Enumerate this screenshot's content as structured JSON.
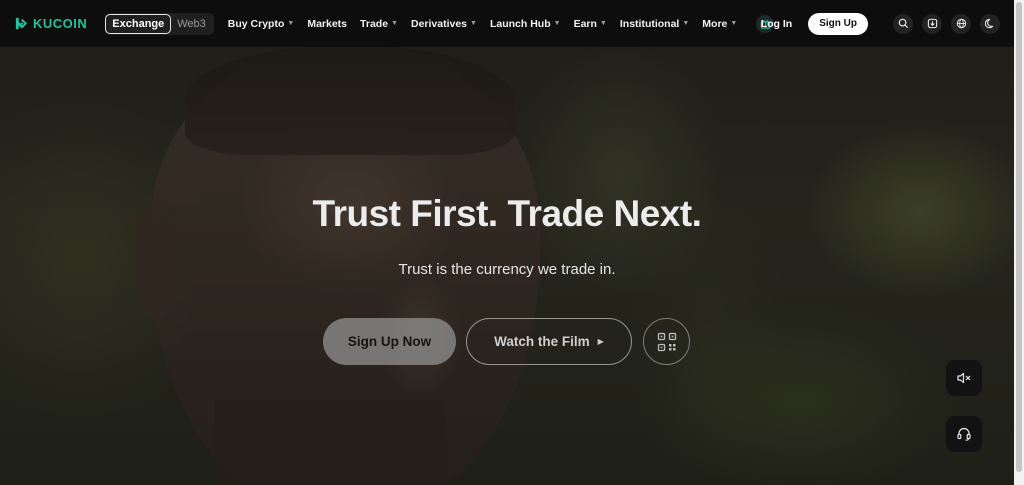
{
  "header": {
    "brand": "KUCOIN",
    "mode_switch": {
      "active": "Exchange",
      "inactive": "Web3"
    },
    "nav": [
      {
        "label": "Buy Crypto",
        "has_dropdown": true
      },
      {
        "label": "Markets",
        "has_dropdown": false
      },
      {
        "label": "Trade",
        "has_dropdown": true
      },
      {
        "label": "Derivatives",
        "has_dropdown": true
      },
      {
        "label": "Launch Hub",
        "has_dropdown": true
      },
      {
        "label": "Earn",
        "has_dropdown": true
      },
      {
        "label": "Institutional",
        "has_dropdown": true
      },
      {
        "label": "More",
        "has_dropdown": true
      }
    ],
    "login_label": "Log In",
    "signup_label": "Sign Up",
    "icons": [
      "gift-icon",
      "search-icon",
      "download-icon",
      "globe-icon",
      "moon-icon"
    ]
  },
  "hero": {
    "title": "Trust First. Trade Next.",
    "subtitle": "Trust is the currency we trade in.",
    "primary_button": "Sign Up Now",
    "secondary_button": "Watch the Film",
    "qr_icon": "qr-code-icon"
  },
  "floating": {
    "mute_icon": "speaker-muted-icon",
    "support_icon": "headset-icon"
  },
  "colors": {
    "brand": "#23c29a",
    "header_bg": "#0d0d0d"
  }
}
